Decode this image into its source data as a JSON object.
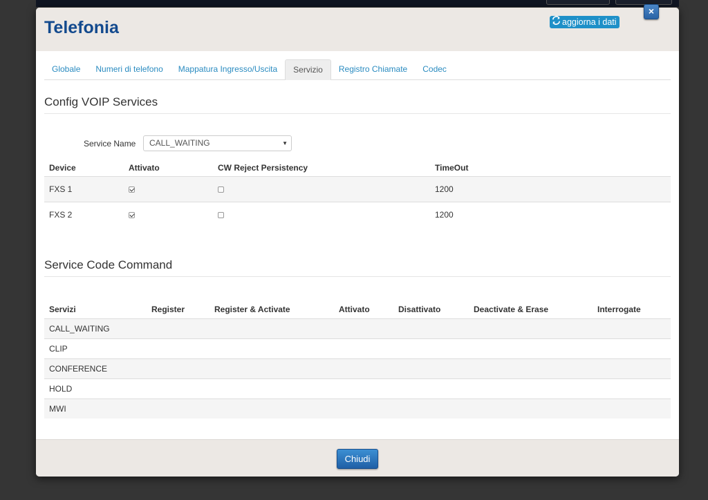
{
  "modal": {
    "title": "Telefonia",
    "refresh_label": "aggiorna i dati",
    "close_label": "×",
    "footer_button": "Chiudi"
  },
  "tabs": [
    {
      "label": "Globale",
      "active": false
    },
    {
      "label": "Numeri di telefono",
      "active": false
    },
    {
      "label": "Mappatura Ingresso/Uscita",
      "active": false
    },
    {
      "label": "Servizio",
      "active": true
    },
    {
      "label": "Registro Chiamate",
      "active": false
    },
    {
      "label": "Codec",
      "active": false
    }
  ],
  "voip": {
    "section_title": "Config VOIP Services",
    "service_name_label": "Service Name",
    "service_name_value": "CALL_WAITING",
    "columns": [
      "Device",
      "Attivato",
      "CW Reject Persistency",
      "TimeOut"
    ],
    "rows": [
      {
        "device": "FXS 1",
        "attivato": true,
        "cw_reject": false,
        "timeout": "1200"
      },
      {
        "device": "FXS 2",
        "attivato": true,
        "cw_reject": false,
        "timeout": "1200"
      }
    ]
  },
  "service_code": {
    "section_title": "Service Code Command",
    "columns": [
      "Servizi",
      "Register",
      "Register & Activate",
      "Attivato",
      "Disattivato",
      "Deactivate & Erase",
      "Interrogate"
    ],
    "rows": [
      "CALL_WAITING",
      "CLIP",
      "CONFERENCE",
      "HOLD",
      "MWI"
    ]
  },
  "icons": {
    "refresh": "refresh-icon",
    "close": "close-icon",
    "caret": "caret-down-icon"
  },
  "colors": {
    "title": "#134a8e",
    "link": "#2a8bc0",
    "primary_button": "#1f5fa6",
    "refresh_button": "#1e90c8"
  }
}
